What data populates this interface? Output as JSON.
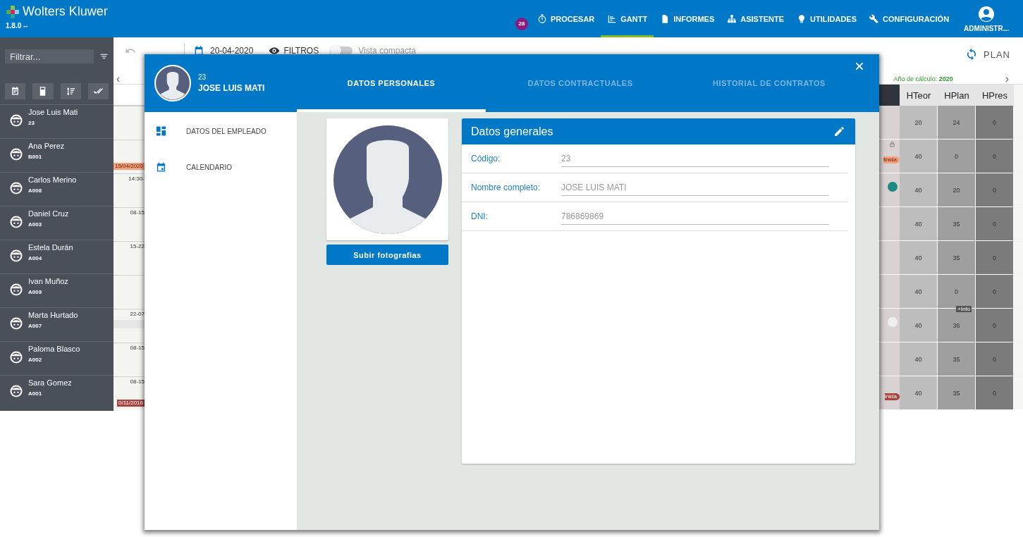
{
  "app": {
    "brand": "Wolters Kluwer",
    "version": "1.8.0 --"
  },
  "nav": {
    "badge": "28",
    "items": [
      {
        "label": "PROCESAR",
        "kind": "timer",
        "selected": false
      },
      {
        "label": "GANTT",
        "kind": "chart",
        "selected": true
      },
      {
        "label": "INFORMES",
        "kind": "report",
        "selected": false
      },
      {
        "label": "ASISTENTE",
        "kind": "tree",
        "selected": false
      },
      {
        "label": "UTILIDADES",
        "kind": "bulb",
        "selected": false
      },
      {
        "label": "CONFIGURACIÓN",
        "kind": "wrench",
        "selected": false
      }
    ],
    "account": "ADMINISTR..."
  },
  "sidebar": {
    "filter_placeholder": "Filtrar...",
    "employees": [
      {
        "name": "Jose Luis Mati",
        "code": "23"
      },
      {
        "name": "Ana Perez",
        "code": "B001"
      },
      {
        "name": "Carlos Merino",
        "code": "A008"
      },
      {
        "name": "Daniel Cruz",
        "code": "A003"
      },
      {
        "name": "Estela Durán",
        "code": "A004"
      },
      {
        "name": "Ivan Muñoz",
        "code": "A009"
      },
      {
        "name": "Marta Hurtado",
        "code": "A007"
      },
      {
        "name": "Paloma Blasco",
        "code": "A002"
      },
      {
        "name": "Sara Gomez",
        "code": "A001"
      }
    ]
  },
  "toolbar": {
    "date": "20-04-2020",
    "filters": "FILTROS",
    "compact_view": "Vista compacta",
    "compact_on": false,
    "plan": "PLAN"
  },
  "gantt": {
    "rows": [
      {
        "time": ""
      },
      {
        "bar": {
          "label": "15/04/2020",
          "color": "#f4a27c"
        },
        "edge": {
          "label": "finida",
          "color": "#f4a27c"
        },
        "locked": true
      },
      {
        "time": "14:30-",
        "edge": {
          "color": "#1a8a82"
        }
      },
      {
        "time": "08-15"
      },
      {
        "time": "15-22"
      },
      {
        "time": ""
      },
      {
        "time": "22-07",
        "shaded": true,
        "edge": {
          "color": "#eeeeee"
        }
      },
      {
        "time": "08-15"
      },
      {
        "time": "08-15",
        "bar": {
          "label": "0/11/2016",
          "color": "#a8433f"
        },
        "edge": {
          "label": "inida",
          "color": "#a8433f"
        }
      }
    ],
    "prev_arrow": "‹",
    "next_arrow": "›"
  },
  "hours": {
    "year_label": "Año de cálculo: **2020**",
    "columns": [
      "HTeor",
      "HPlan",
      "HPres"
    ],
    "rows": [
      [
        "20",
        "24",
        "0"
      ],
      [
        "40",
        "0",
        "0"
      ],
      [
        "40",
        "20",
        "0"
      ],
      [
        "40",
        "35",
        "0"
      ],
      [
        "40",
        "35",
        "0"
      ],
      [
        "40",
        "0",
        "0"
      ],
      [
        "40",
        "36",
        "0"
      ],
      [
        "40",
        "35",
        "0"
      ],
      [
        "40",
        "35",
        "0"
      ]
    ],
    "info_tag": "+Info"
  },
  "modal": {
    "employee_code": "23",
    "employee_name": "JOSE LUIS MATI",
    "tabs": [
      {
        "label": "DATOS PERSONALES",
        "selected": true
      },
      {
        "label": "DATOS CONTRACTUALES",
        "selected": false
      },
      {
        "label": "HISTORIAL DE CONTRATOS",
        "selected": false
      }
    ],
    "menu": [
      {
        "label": "DATOS DEL EMPLEADO",
        "kind": "dashboard"
      },
      {
        "label": "CALENDARIO",
        "kind": "calendar"
      }
    ],
    "upload_button": "Subir fotografias",
    "card": {
      "title": "Datos generales",
      "fields": [
        {
          "label": "Código:",
          "value": "23"
        },
        {
          "label": "Nombre completo:",
          "value": "JOSE LUIS MATI"
        },
        {
          "label": "DNI:",
          "value": "786869869"
        }
      ]
    }
  }
}
